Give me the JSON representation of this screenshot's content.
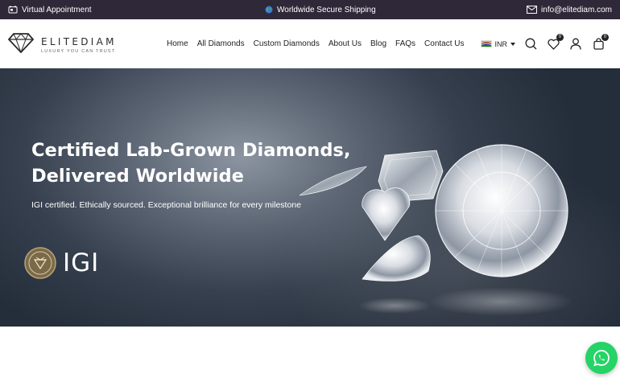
{
  "topbar": {
    "left_label": "Virtual Appointment",
    "center_label": "Worldwide Secure Shipping",
    "email": "info@elitediam.com"
  },
  "brand": {
    "name": "ELITEDIAM",
    "tagline": "LUXURY YOU CAN TRUST"
  },
  "nav": {
    "items": [
      {
        "label": "Home"
      },
      {
        "label": "All Diamonds"
      },
      {
        "label": "Custom Diamonds"
      },
      {
        "label": "About Us"
      },
      {
        "label": "Blog"
      },
      {
        "label": "FAQs"
      },
      {
        "label": "Contact Us"
      }
    ]
  },
  "tools": {
    "currency": "INR",
    "wishlist_count": "0",
    "cart_count": "0"
  },
  "hero": {
    "title_line1": "Certified Lab-Grown Diamonds,",
    "title_line2": "Delivered Worldwide",
    "subtitle": "IGI certified. Ethically sourced. Exceptional brilliance for every milestone",
    "cert_logo_text": "IGI"
  },
  "colors": {
    "topbar_bg": "#2f2838",
    "whatsapp": "#25d366",
    "flag_saffron": "#ff9933",
    "flag_green": "#138808"
  },
  "icons": {
    "topbar_left": "virtual-appointment-icon",
    "topbar_center": "globe-icon",
    "topbar_right": "mail-icon",
    "search": "search-icon",
    "wishlist": "heart-icon",
    "account": "user-icon",
    "cart": "shopping-bag-icon",
    "chat": "whatsapp-icon"
  }
}
